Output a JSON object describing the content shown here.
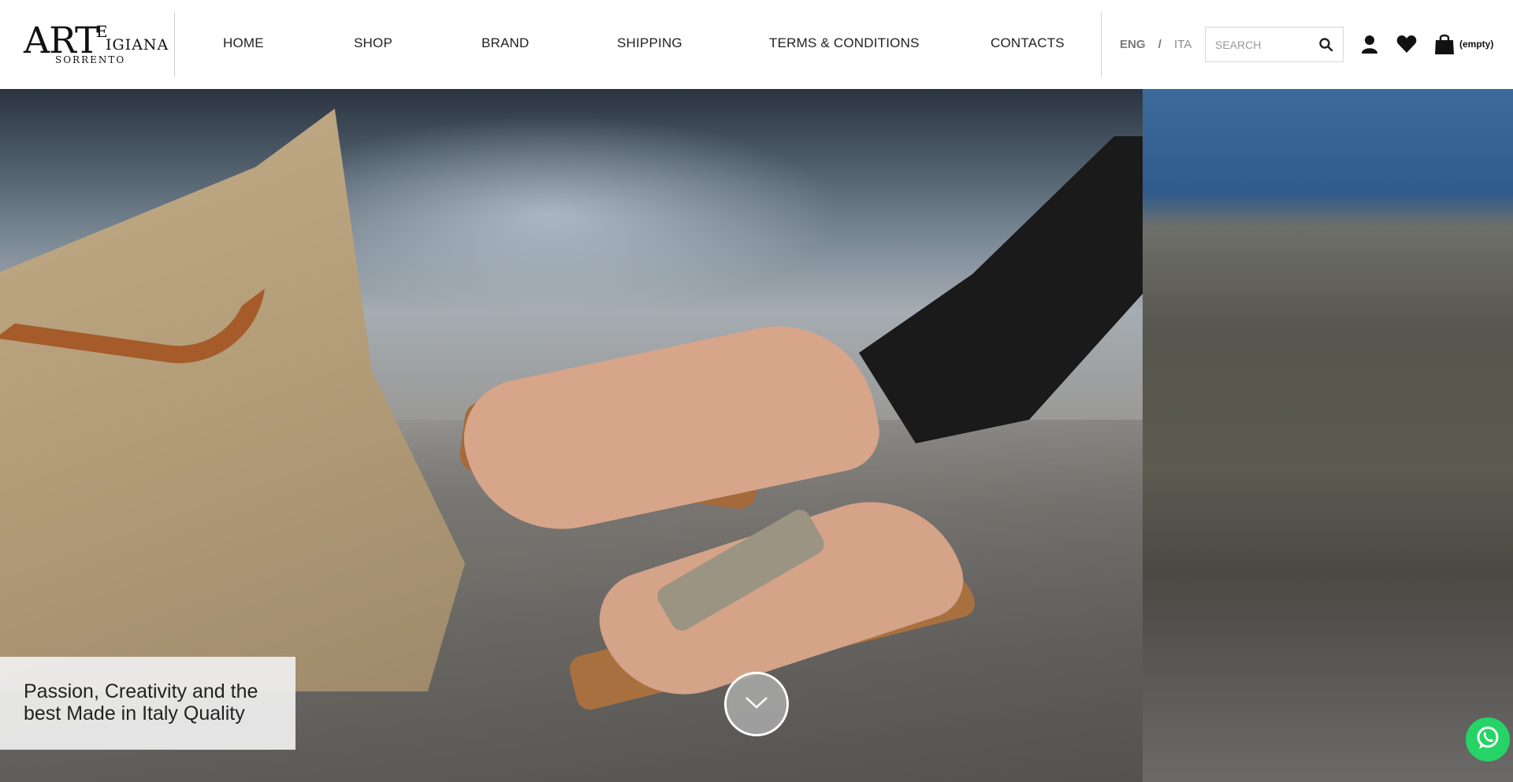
{
  "brand": {
    "logo_art": "ART",
    "logo_e": "E",
    "logo_igiana": "IGIANA",
    "logo_sorrento": "SORRENTO"
  },
  "nav": {
    "items": [
      "HOME",
      "SHOP",
      "BRAND",
      "SHIPPING",
      "TERMS & CONDITIONS",
      "CONTACTS"
    ]
  },
  "language": {
    "eng": "ENG",
    "separator": "/",
    "ita": "ITA"
  },
  "search": {
    "placeholder": "SEARCH",
    "icon": "search-icon"
  },
  "account": {
    "icon": "user-icon"
  },
  "wishlist": {
    "icon": "heart-icon"
  },
  "cart": {
    "icon": "shopping-bag-icon",
    "label": "(empty)"
  },
  "hero": {
    "caption": "Passion, Creativity and the best Made in Italy Quality",
    "scroll_icon": "chevron-down-icon"
  },
  "chat": {
    "icon": "whatsapp-icon"
  },
  "colors": {
    "text": "#222222",
    "muted": "#8a8a8a",
    "whatsapp": "#25d366"
  }
}
